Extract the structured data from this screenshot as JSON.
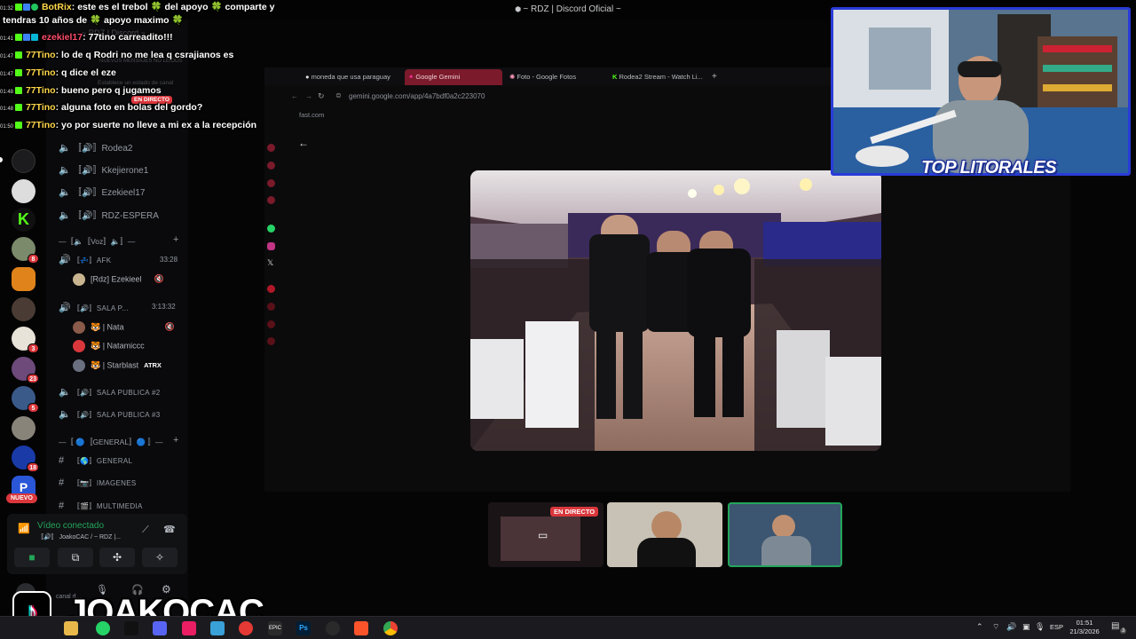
{
  "window": {
    "title": "~ RDZ | Discord Oficial ~"
  },
  "chat": {
    "lines": [
      {
        "time": "01:32",
        "user": "BotRix",
        "text": ": este es el trebol",
        "mid": "del apoyo",
        "tail": "comparte y"
      },
      {
        "cont": "tendras 10 años de",
        "cont_mid": "apoyo maximo"
      },
      {
        "time": "01:41",
        "user": "ezekiel17",
        "text": ": 77tino carreadito!!!"
      },
      {
        "time": "01:47",
        "user": "77Tino",
        "text": ": lo de q Rodri no me lea q csrajianos es"
      },
      {
        "time": "01:47",
        "user": "77Tino",
        "text": ": q dice el eze"
      },
      {
        "time": "01:48",
        "user": "77Tino",
        "text": ": bueno pero q jugamos"
      },
      {
        "time": "01:48",
        "user": "77Tino",
        "text": ": alguna foto en bolas del gordo?"
      },
      {
        "time": "01:50",
        "user": "77Tino",
        "text": ": yo por suerte no lleve a mi ex a la recepción"
      }
    ]
  },
  "servers": {
    "badges": [
      "8",
      "3",
      "23",
      "5",
      "18"
    ],
    "new_label": "NUEVO"
  },
  "channels": {
    "header_ghost": "~ RDZ | Discord ~",
    "unread_ghost": "NUEVOS MENSAJES NO LEÍDOS",
    "status_ghost": "Establece un estado de canal",
    "live_badge": "EN DIRECTO",
    "voice_items": [
      {
        "prefix": "〚🔊〛",
        "name": "Rodea2"
      },
      {
        "prefix": "〚🔊〛",
        "name": "Kkejierone1"
      },
      {
        "prefix": "〚🔊〛",
        "name": "Ezekieel17"
      },
      {
        "prefix": "〚🔊〛",
        "name": "RDZ-ESPERA"
      }
    ],
    "voice_category": "—〚🔈〚Voz〛🔈〛—",
    "afk": {
      "prefix": "〚💤〛",
      "name": "AFK",
      "duration": "33:28"
    },
    "afk_user": "[Rdz] Ezekieel",
    "sala_p": {
      "prefix": "〚🔊〛",
      "name": "SALA P...",
      "duration": "3:13:32"
    },
    "sala_users": [
      {
        "name": "| Nata"
      },
      {
        "name": "| Natamiccc"
      },
      {
        "name": "| Starblast",
        "tag": "ATRX"
      }
    ],
    "sala_publica_2": {
      "prefix": "〚🔊〛",
      "name": "SALA PUBLICA #2"
    },
    "sala_publica_3": {
      "prefix": "〚🔊〛",
      "name": "SALA PUBLICA #3"
    },
    "general_category": "—〚 🔵〚GENERAL〛🔵 〛—",
    "text_channels": [
      {
        "prefix": "〚🌎〛",
        "name": "GENERAL"
      },
      {
        "prefix": "〚📷〛",
        "name": "IMAGENES"
      },
      {
        "prefix": "〚🎬〛",
        "name": "MULTIMEDIA"
      }
    ]
  },
  "voice_panel": {
    "status": "Vídeo conectado",
    "channel": "〚🔊〛 JoakoCAC / ~ RDZ |..."
  },
  "user_panel": {
    "ghost": "canal d..."
  },
  "browser": {
    "tabs": [
      {
        "label": "moneda que usa paraguay"
      },
      {
        "label": "Google Gemini"
      },
      {
        "label": "Foto - Google Fotos"
      },
      {
        "label": "Rodea2 Stream - Watch Li..."
      }
    ],
    "new_tab": "+",
    "url": "gemini.google.com/app/4a7bdf0a2c223070",
    "bookmark": "fast.com"
  },
  "webcam": {
    "overlay_logo": "TOP LITORALES"
  },
  "thumbnails": {
    "live_badge": "EN DIRECTO"
  },
  "brand": {
    "name": "JOAKOCAC"
  },
  "taskbar": {
    "lang": "ESP",
    "time": "01:51",
    "date": "21/3/2026",
    "notif_count": "3"
  }
}
